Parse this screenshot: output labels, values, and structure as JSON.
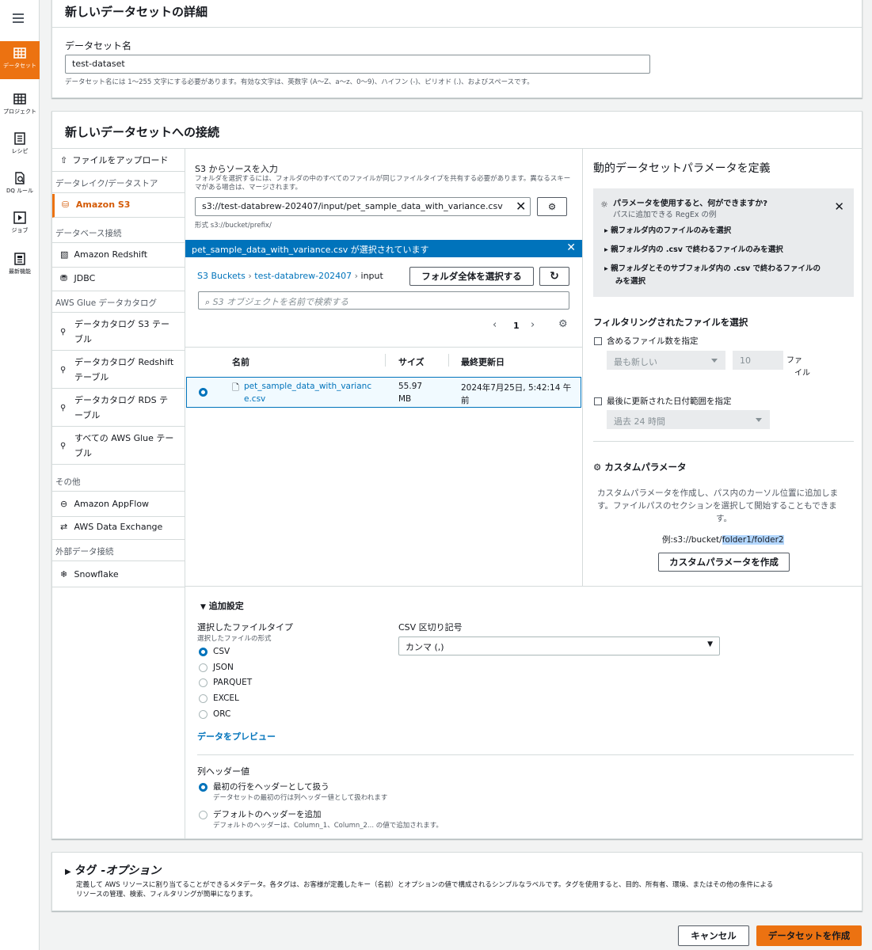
{
  "nav": {
    "items": [
      {
        "label": "データセット",
        "active": true
      },
      {
        "label": "プロジェクト"
      },
      {
        "label": "レシピ"
      },
      {
        "label": "DQ ルール"
      },
      {
        "label": "ジョブ"
      },
      {
        "label": "最新機能"
      }
    ]
  },
  "details": {
    "title": "新しいデータセットの詳細",
    "name_label": "データセット名",
    "name_value": "test-dataset",
    "name_hint": "データセット名には 1〜255 文字にする必要があります。有効な文字は、英数字 (A〜Z、a〜z、0〜9)、ハイフン (-)、ピリオド (.)、およびスペースです。"
  },
  "connect": {
    "title": "新しいデータセットへの接続",
    "sidebar": {
      "upload": "ファイルをアップロード",
      "cat_lake": "データレイク/データストア",
      "s3": "Amazon S3",
      "cat_db": "データベース接続",
      "redshift": "Amazon Redshift",
      "jdbc": "JDBC",
      "cat_glue": "AWS Glue データカタログ",
      "glue_s3": "データカタログ S3 テーブル",
      "glue_redshift": "データカタログ Redshift テーブル",
      "glue_rds": "データカタログ RDS テーブル",
      "glue_all": "すべての AWS Glue テーブル",
      "cat_other": "その他",
      "appflow": "Amazon AppFlow",
      "data_exchange": "AWS Data Exchange",
      "cat_external": "外部データ接続",
      "snowflake": "Snowflake"
    },
    "source": {
      "label": "S3 からソースを入力",
      "hint": "フォルダを選択するには、フォルダの中のすべてのファイルが同じファイルタイプを共有する必要があります。異なるスキーマがある場合は、マージされます。",
      "value": "s3://test-databrew-202407/input/pet_sample_data_with_variance.csv",
      "format_hint": "形式 s3://bucket/prefix/",
      "banner": "pet_sample_data_with_variance.csv が選択されています",
      "crumb_root": "S3 Buckets",
      "crumb_bucket": "test-databrew-202407",
      "crumb_folder": "input",
      "select_folder": "フォルダ全体を選択する",
      "search_placeholder": "S3 オブジェクトを名前で検索する",
      "page": "1",
      "col_name": "名前",
      "col_size": "サイズ",
      "col_modified": "最終更新日",
      "row_name_1": "pet_sample_data_with_varianc",
      "row_name_2": "e.csv",
      "row_size_1": "55.97",
      "row_size_2": "MB",
      "row_date_1": "2024年7月25日, 5:42:14 午",
      "row_date_2": "前"
    },
    "params": {
      "title": "動的データセットパラメータを定義",
      "info_title": "パラメータを使用すると、何ができますか?",
      "info_sub": "パスに追加できる RegEx の例",
      "bullet1": "親フォルダ内のファイルのみを選択",
      "bullet2": "親フォルダ内の .csv で終わるファイルのみを選択",
      "bullet3a": "親フォルダとそのサブフォルダ内の .csv で終わるファイルの",
      "bullet3b": "みを選択",
      "filter_title": "フィルタリングされたファイルを選択",
      "count_label": "含めるファイル数を指定",
      "count_order": "最も新しい",
      "count_value": "10",
      "count_unit1": "ファ",
      "count_unit2": "イル",
      "date_label": "最後に更新された日付範囲を指定",
      "date_value": "過去 24 時間",
      "custom_title": "カスタムパラメータ",
      "custom_desc1": "カスタムパラメータを作成し、パス内のカーソル位置に追加しま",
      "custom_desc2": "す。ファイルパスのセクションを選択して開始することもできま",
      "custom_desc3": "す。",
      "example_prefix": "例:s3://bucket/",
      "example_highlight": "folder1/folder2",
      "custom_button": "カスタムパラメータを作成"
    },
    "extra": {
      "title": "追加設定",
      "filetype_label": "選択したファイルタイプ",
      "filetype_hint": "選択したファイルの形式",
      "types": [
        "CSV",
        "JSON",
        "PARQUET",
        "EXCEL",
        "ORC"
      ],
      "selected_type": "CSV",
      "delim_label": "CSV 区切り記号",
      "delim_value": "カンマ (,)",
      "preview": "データをプレビュー",
      "header_label": "列ヘッダー値",
      "header_opt1": "最初の行をヘッダーとして扱う",
      "header_opt1_hint": "データセットの最初の行は列ヘッダー値として扱われます",
      "header_opt2": "デフォルトのヘッダーを追加",
      "header_opt2_hint": "デフォルトのヘッダーは、Column_1、Column_2... の値で追加されます。"
    }
  },
  "tags": {
    "title": "タグ",
    "title_opt": "-オプション",
    "desc1": "定義して AWS リソースに割り当てることができるメタデータ。各タグは、お客様が定義したキー（名前）とオプションの値で構成されるシンプルなラベルです。タグを使用すると、目的、所有者、環境、またはその他の条件による",
    "desc2": "リソースの管理、検索、フィルタリングが簡単になります。"
  },
  "footer": {
    "cancel": "キャンセル",
    "create": "データセットを作成"
  },
  "colors": {
    "accent": "#ec7211",
    "link": "#0073bb",
    "banner": "#0073bb"
  }
}
